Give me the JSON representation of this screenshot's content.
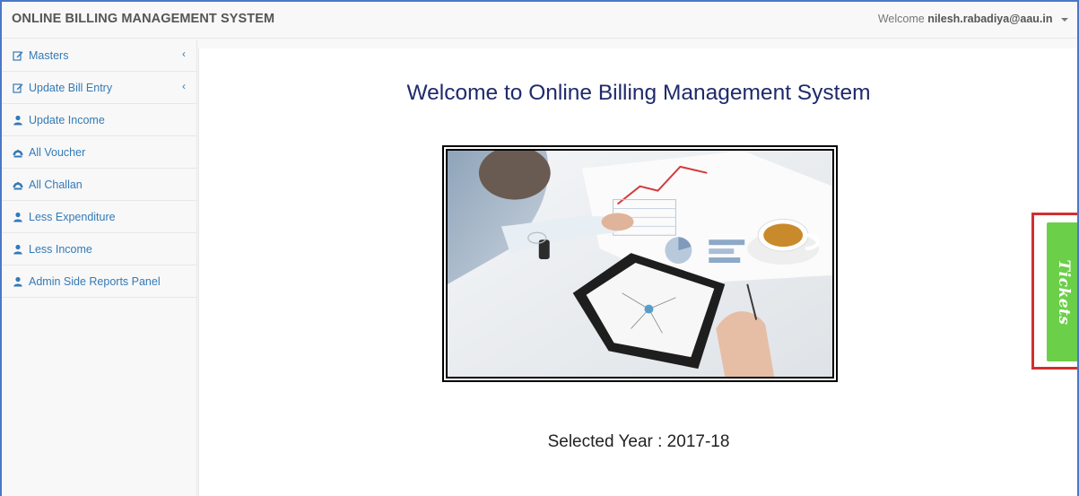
{
  "app": {
    "title": "ONLINE BILLING MANAGEMENT SYSTEM"
  },
  "user_menu": {
    "welcome_text": "Welcome",
    "username": "nilesh.rabadiya@aau.in",
    "icon": "caret-down-icon"
  },
  "sidebar": {
    "items": [
      {
        "label": "Masters",
        "icon": "edit-icon",
        "has_submenu": true
      },
      {
        "label": "Update Bill Entry",
        "icon": "edit-icon",
        "has_submenu": true
      },
      {
        "label": "Update Income",
        "icon": "user-icon",
        "has_submenu": false
      },
      {
        "label": "All Voucher",
        "icon": "dashboard-icon",
        "has_submenu": false
      },
      {
        "label": "All Challan",
        "icon": "dashboard-icon",
        "has_submenu": false
      },
      {
        "label": "Less Expenditure",
        "icon": "user-icon",
        "has_submenu": false
      },
      {
        "label": "Less Income",
        "icon": "user-icon",
        "has_submenu": false
      },
      {
        "label": "Admin Side Reports Panel",
        "icon": "user-icon",
        "has_submenu": false
      }
    ],
    "chevron_glyph": "‹"
  },
  "main": {
    "welcome_heading": "Welcome to Online Billing Management System",
    "selected_year_label": "Selected Year : 2017-18"
  },
  "tickets": {
    "label": "Tickets",
    "color": "#6ccf4a",
    "highlight_color": "#d32f2f"
  },
  "colors": {
    "link": "#337ab7",
    "heading": "#1f2a6b"
  }
}
